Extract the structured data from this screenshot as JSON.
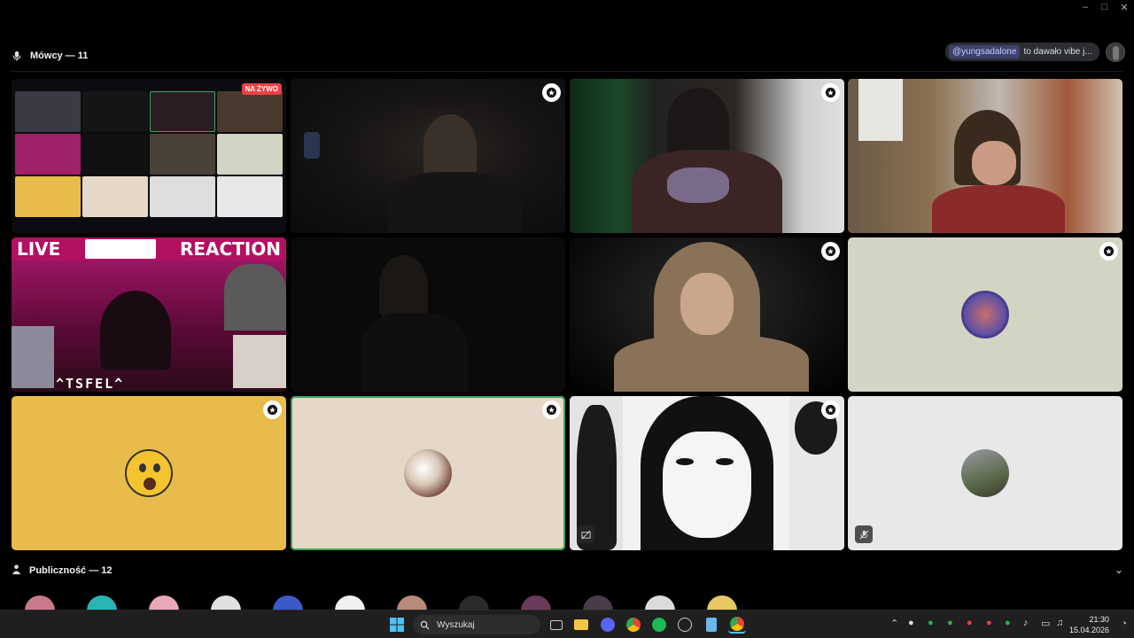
{
  "window_controls": [
    "–",
    "□",
    "✕"
  ],
  "speakers": {
    "label": "Mówcy — 11"
  },
  "chat_notification": {
    "mention": "@yungsadalone",
    "text": "to dawało vibe j..."
  },
  "tiles": [
    {
      "id": "stream",
      "live_badge": "NA ŻYWO"
    },
    {
      "id": "cam-dark-man",
      "speaking": false
    },
    {
      "id": "cam-green-room",
      "speaking": true
    },
    {
      "id": "cam-curly-headset",
      "speaking": false
    },
    {
      "id": "reaction-stream",
      "left_text": "LIVE",
      "right_text": "REACTION",
      "caption": "^TSFEL^"
    },
    {
      "id": "cam-dark-room",
      "speaking": false
    },
    {
      "id": "cam-hoodie",
      "speaking": false
    },
    {
      "id": "avatar-beige-gray",
      "speaking": false
    },
    {
      "id": "avatar-yellow-emoji",
      "speaking": false
    },
    {
      "id": "avatar-beige",
      "speaking": true
    },
    {
      "id": "manga-screen",
      "speaking": false
    },
    {
      "id": "avatar-light-gray",
      "speaking": false,
      "muted": true
    }
  ],
  "audience": {
    "label": "Publiczność — 12"
  },
  "taskbar": {
    "search_placeholder": "Wyszukaj",
    "time": "21:30",
    "date": "15.04.2026"
  },
  "colors": {
    "speaking_border": "#3ba55d",
    "live_red": "#ed4245",
    "background": "#000000",
    "yellow_tile": "#e8bc4c",
    "beige_tile": "#e6d8c8",
    "gray_tile": "#d4d4c4"
  }
}
